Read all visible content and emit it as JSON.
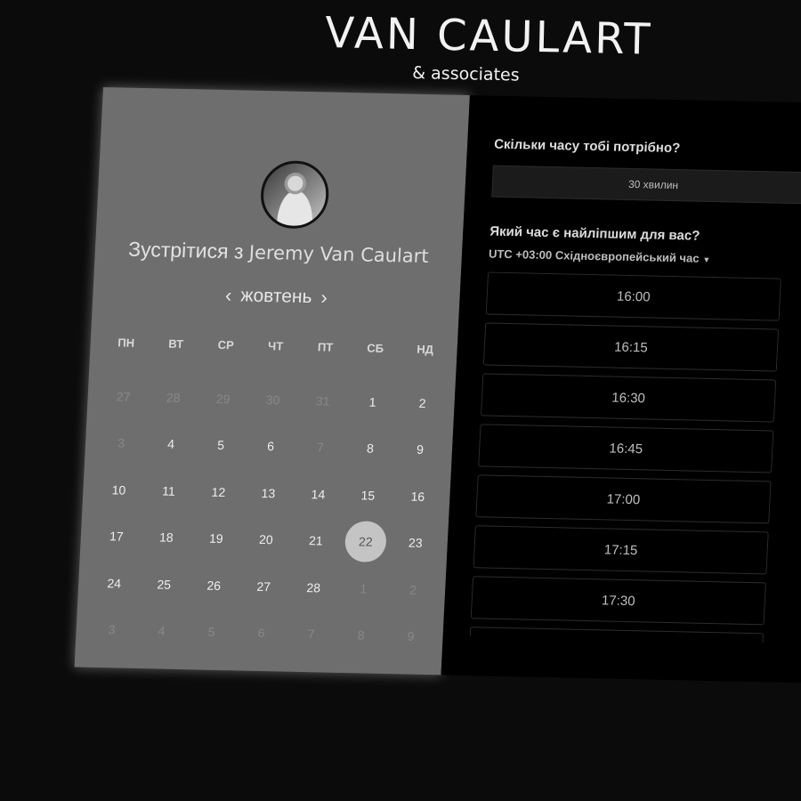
{
  "brand": {
    "name": "VAN CAULART",
    "subtitle": "& associates"
  },
  "booking": {
    "meet_prefix": "Зустрітися з",
    "host_name": "Jeremy Van Caulart",
    "month": "жовтень",
    "prev_icon": "chevron-left-icon",
    "next_icon": "chevron-right-icon",
    "weekdays": [
      "ПН",
      "ВТ",
      "СР",
      "ЧТ",
      "ПТ",
      "СБ",
      "НД"
    ],
    "days": [
      {
        "d": "27",
        "muted": true
      },
      {
        "d": "28",
        "muted": true
      },
      {
        "d": "29",
        "muted": true
      },
      {
        "d": "30",
        "muted": true
      },
      {
        "d": "31",
        "muted": true
      },
      {
        "d": "1"
      },
      {
        "d": "2"
      },
      {
        "d": "3",
        "muted": true
      },
      {
        "d": "4"
      },
      {
        "d": "5"
      },
      {
        "d": "6"
      },
      {
        "d": "7",
        "muted": true
      },
      {
        "d": "8"
      },
      {
        "d": "9"
      },
      {
        "d": "10"
      },
      {
        "d": "11"
      },
      {
        "d": "12"
      },
      {
        "d": "13"
      },
      {
        "d": "14"
      },
      {
        "d": "15"
      },
      {
        "d": "16"
      },
      {
        "d": "17"
      },
      {
        "d": "18"
      },
      {
        "d": "19"
      },
      {
        "d": "20"
      },
      {
        "d": "21"
      },
      {
        "d": "22",
        "selected": true
      },
      {
        "d": "23"
      },
      {
        "d": "24"
      },
      {
        "d": "25"
      },
      {
        "d": "26"
      },
      {
        "d": "27"
      },
      {
        "d": "28"
      },
      {
        "d": "1",
        "muted": true
      },
      {
        "d": "2",
        "muted": true
      },
      {
        "d": "3",
        "muted": true
      },
      {
        "d": "4",
        "muted": true
      },
      {
        "d": "5",
        "muted": true
      },
      {
        "d": "6",
        "muted": true
      },
      {
        "d": "7",
        "muted": true
      },
      {
        "d": "8",
        "muted": true
      },
      {
        "d": "9",
        "muted": true
      }
    ],
    "selected_day": "22"
  },
  "options": {
    "duration_question": "Скільки часу тобі потрібно?",
    "duration_value": "30 хвилин",
    "time_question": "Який час є найліпшим для вас?",
    "timezone": "UTC +03:00 Східноєвропейський час",
    "timezone_icon": "caret-down-icon",
    "slots": [
      "16:00",
      "16:15",
      "16:30",
      "16:45",
      "17:00",
      "17:15",
      "17:30",
      ""
    ]
  }
}
